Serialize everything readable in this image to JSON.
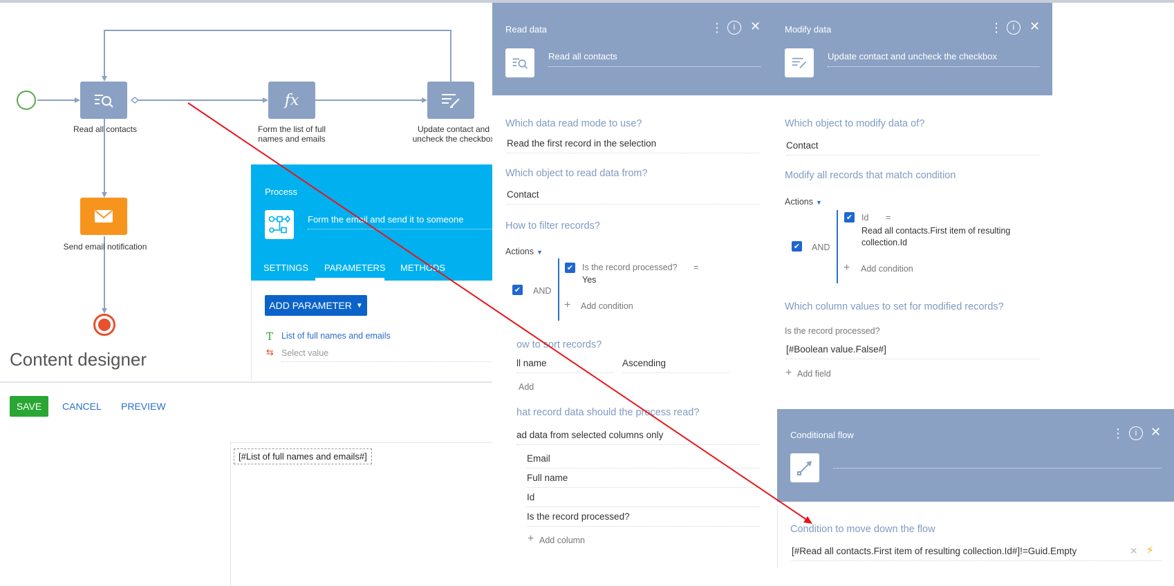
{
  "diagram": {
    "nodes": {
      "read_all": "Read all contacts",
      "form_list": "Form the list of full names and emails",
      "form_list_l1": "Form the list of full",
      "form_list_l2": "names and emails",
      "update_l1": "Update contact and",
      "update_l2": "uncheck the checkbox",
      "send_email": "Send email notification"
    },
    "fx_label": "fx"
  },
  "content_designer": {
    "title": "Content designer",
    "save": "SAVE",
    "cancel": "CANCEL",
    "preview": "PREVIEW",
    "token": "[#List of full names and emails#]"
  },
  "process_panel": {
    "title": "Process",
    "caption": "Form the email and send it to someone",
    "tabs": [
      "SETTINGS",
      "PARAMETERS",
      "METHODS"
    ],
    "active_tab": "PARAMETERS",
    "add_parameter": "ADD PARAMETER",
    "param_name": "List of full names and emails",
    "param_value_placeholder": "Select value",
    "colors": {
      "header": "#00b0ef",
      "button": "#0b63c9"
    }
  },
  "read_data": {
    "title": "Read data",
    "caption": "Read all contacts",
    "q_mode": "Which data read mode to use?",
    "mode_value": "Read the first record in the selection",
    "q_object": "Which object to read data from?",
    "object_value": "Contact",
    "q_filter": "How to filter records?",
    "actions": "Actions",
    "and": "AND",
    "cond_field": "Is the record processed?",
    "cond_op": "=",
    "cond_value": "Yes",
    "add_condition": "Add condition",
    "q_sort": "ow to sort records?",
    "sort_field": "ll name",
    "sort_dir": "Ascending",
    "add": "Add",
    "q_columns": "hat record data should the process read?",
    "columns_mode": "ad data from selected columns only",
    "columns": [
      "Email",
      "Full name",
      "Id",
      "Is the record processed?"
    ],
    "add_column": "Add column"
  },
  "modify_data": {
    "title": "Modify data",
    "caption": "Update contact and uncheck the checkbox",
    "q_object": "Which object to modify data of?",
    "object_value": "Contact",
    "q_condition": "Modify all records that match condition",
    "actions": "Actions",
    "and": "AND",
    "cond_field": "Id",
    "cond_op": "=",
    "cond_value_l1": "Read all contacts.First item of resulting",
    "cond_value_l2": "collection.Id",
    "add_condition": "Add condition",
    "q_values": "Which column values to set for modified records?",
    "field_label": "Is the record processed?",
    "field_value": "[#Boolean value.False#]",
    "add_field": "Add field"
  },
  "conditional_flow": {
    "title": "Conditional flow",
    "q_condition": "Condition to move down the flow",
    "condition_value": "[#Read all contacts.First item of resulting collection.Id#]!=Guid.Empty"
  },
  "colors": {
    "panel_header": "#8aa1c4",
    "question_text": "#7f9bc2",
    "checkbox": "#1f66d1",
    "save": "#29a633",
    "start": "#5aa84a",
    "end": "#e8502e",
    "email_node": "#f7941d",
    "annotation_arrow": "#e8141b"
  },
  "icons": [
    "filter-search-icon",
    "fx-icon",
    "edit-list-icon",
    "envelope-icon",
    "process-icon",
    "kebab-menu-icon",
    "info-icon",
    "close-icon",
    "conditional-flow-icon",
    "text-type-icon",
    "mapping-icon",
    "lightning-icon",
    "clear-icon",
    "caret-down-icon",
    "plus-icon",
    "check-icon"
  ]
}
